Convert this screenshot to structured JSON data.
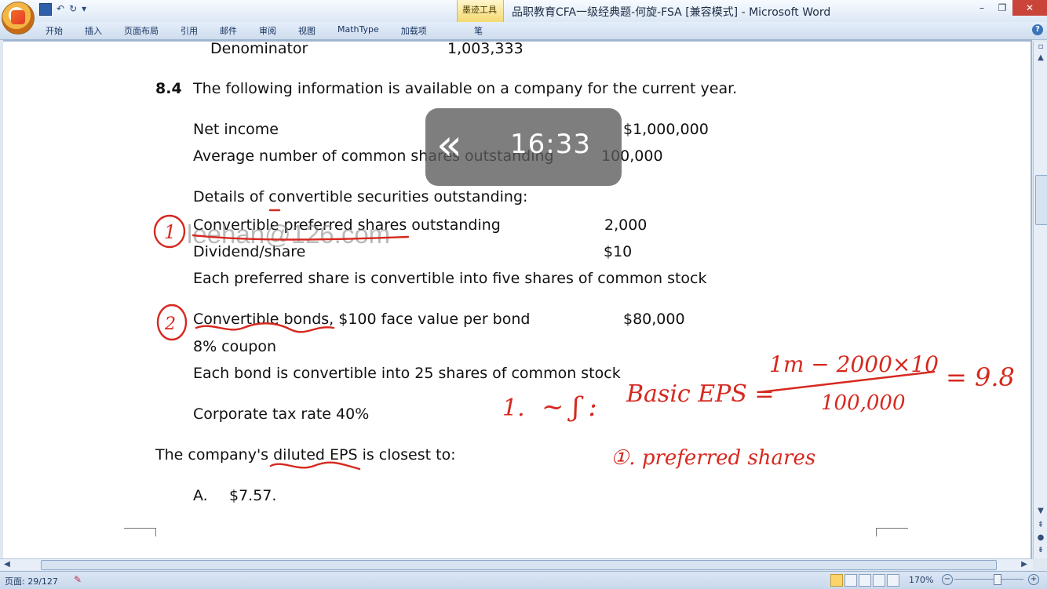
{
  "window": {
    "title": "品职教育CFA一级经典题-何旋-FSA [兼容模式] - Microsoft Word",
    "contextual_group": "墨迹工具",
    "tabs": [
      "开始",
      "插入",
      "页面布局",
      "引用",
      "邮件",
      "审阅",
      "视图",
      "MathType",
      "加载项"
    ],
    "pen_tab": "笔",
    "controls": {
      "minimize": "–",
      "restore": "❐",
      "close": "✕"
    },
    "help": "?"
  },
  "document": {
    "prev_label": "Denominator",
    "prev_value": "1,003,333",
    "question_number": "8.4",
    "question_text": "The following information is available on a company for the current year.",
    "net_income_label": "Net income",
    "net_income_value": "$1,000,000",
    "avg_shares_label": "Average number of common shares outstanding",
    "avg_shares_value": "100,000",
    "details_label": "Details of convertible securities outstanding:",
    "pref_label": "Convertible preferred shares outstanding",
    "pref_value": "2,000",
    "dividend_label": "Dividend/share",
    "dividend_value": "$10",
    "pref_conversion": "Each preferred share is convertible into five shares of common stock",
    "bonds_label": "Convertible bonds, $100 face value per bond",
    "bonds_value": "$80,000",
    "coupon": "8% coupon",
    "bond_conversion": "Each bond is convertible into 25 shares of common stock",
    "tax_rate": "Corporate tax rate 40%",
    "stem": "The company's diluted EPS is closest to:",
    "option_a_letter": "A.",
    "option_a_value": "$7.57."
  },
  "overlay": {
    "time": "16:33",
    "rewind_icon": "«"
  },
  "watermark": "leehan@126.com",
  "annotations": {
    "circle1": "1",
    "circle2": "2",
    "step": "1.",
    "basic": "Basic EPS =",
    "numerator": "1m − 2000×10",
    "denominator": "100,000",
    "result": "= 9.8",
    "preferred": "①. preferred shares"
  },
  "status": {
    "page_count": "页面: 29/127",
    "zoom": "170%"
  }
}
